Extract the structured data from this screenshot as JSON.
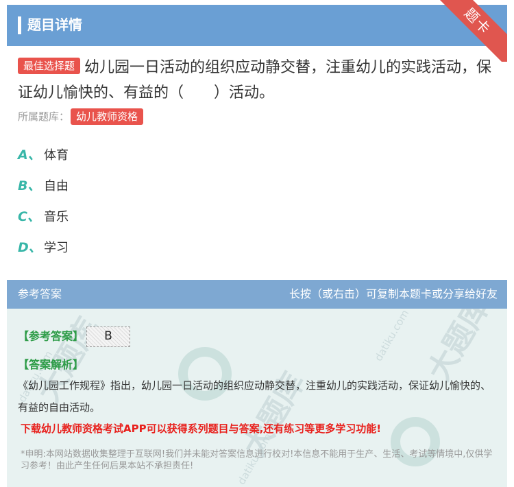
{
  "header": {
    "title": "题目详情",
    "ribbon": "题卡"
  },
  "question": {
    "tag": "最佳选择题",
    "text": "幼儿园一日活动的组织应动静交替，注重幼儿的实践活动，保证幼儿愉快的、有益的（　　）活动。",
    "bank_label": "所属题库：",
    "bank_name": "幼儿教师资格"
  },
  "options": [
    {
      "letter": "A、",
      "text": "体育"
    },
    {
      "letter": "B、",
      "text": "自由"
    },
    {
      "letter": "C、",
      "text": "音乐"
    },
    {
      "letter": "D、",
      "text": "学习"
    }
  ],
  "answer": {
    "header_left": "参考答案",
    "header_right": "长按（或右击）可复制本题卡或分享给好友",
    "ref_label": "【参考答案】",
    "ref_value": "B",
    "analysis_label": "【答案解析】",
    "analysis_text": "《幼儿园工作规程》指出，幼儿园一日活动的组织应动静交替，注重幼儿的实践活动，保证幼儿愉快的、有益的自由活动。",
    "promo": "下载幼儿教师资格考试APP可以获得系列题目与答案,还有练习等更多学习功能!",
    "disclaimer": "*申明:本网站数据收集整理于互联网!我们并未能对答案信息进行校对!本信息不能用于生产、生活、考试等情境中,仅供学习参考！由此产生任何后果本站不承担责任!"
  },
  "watermark": {
    "text": "大题库",
    "site": "datiku.com"
  }
}
